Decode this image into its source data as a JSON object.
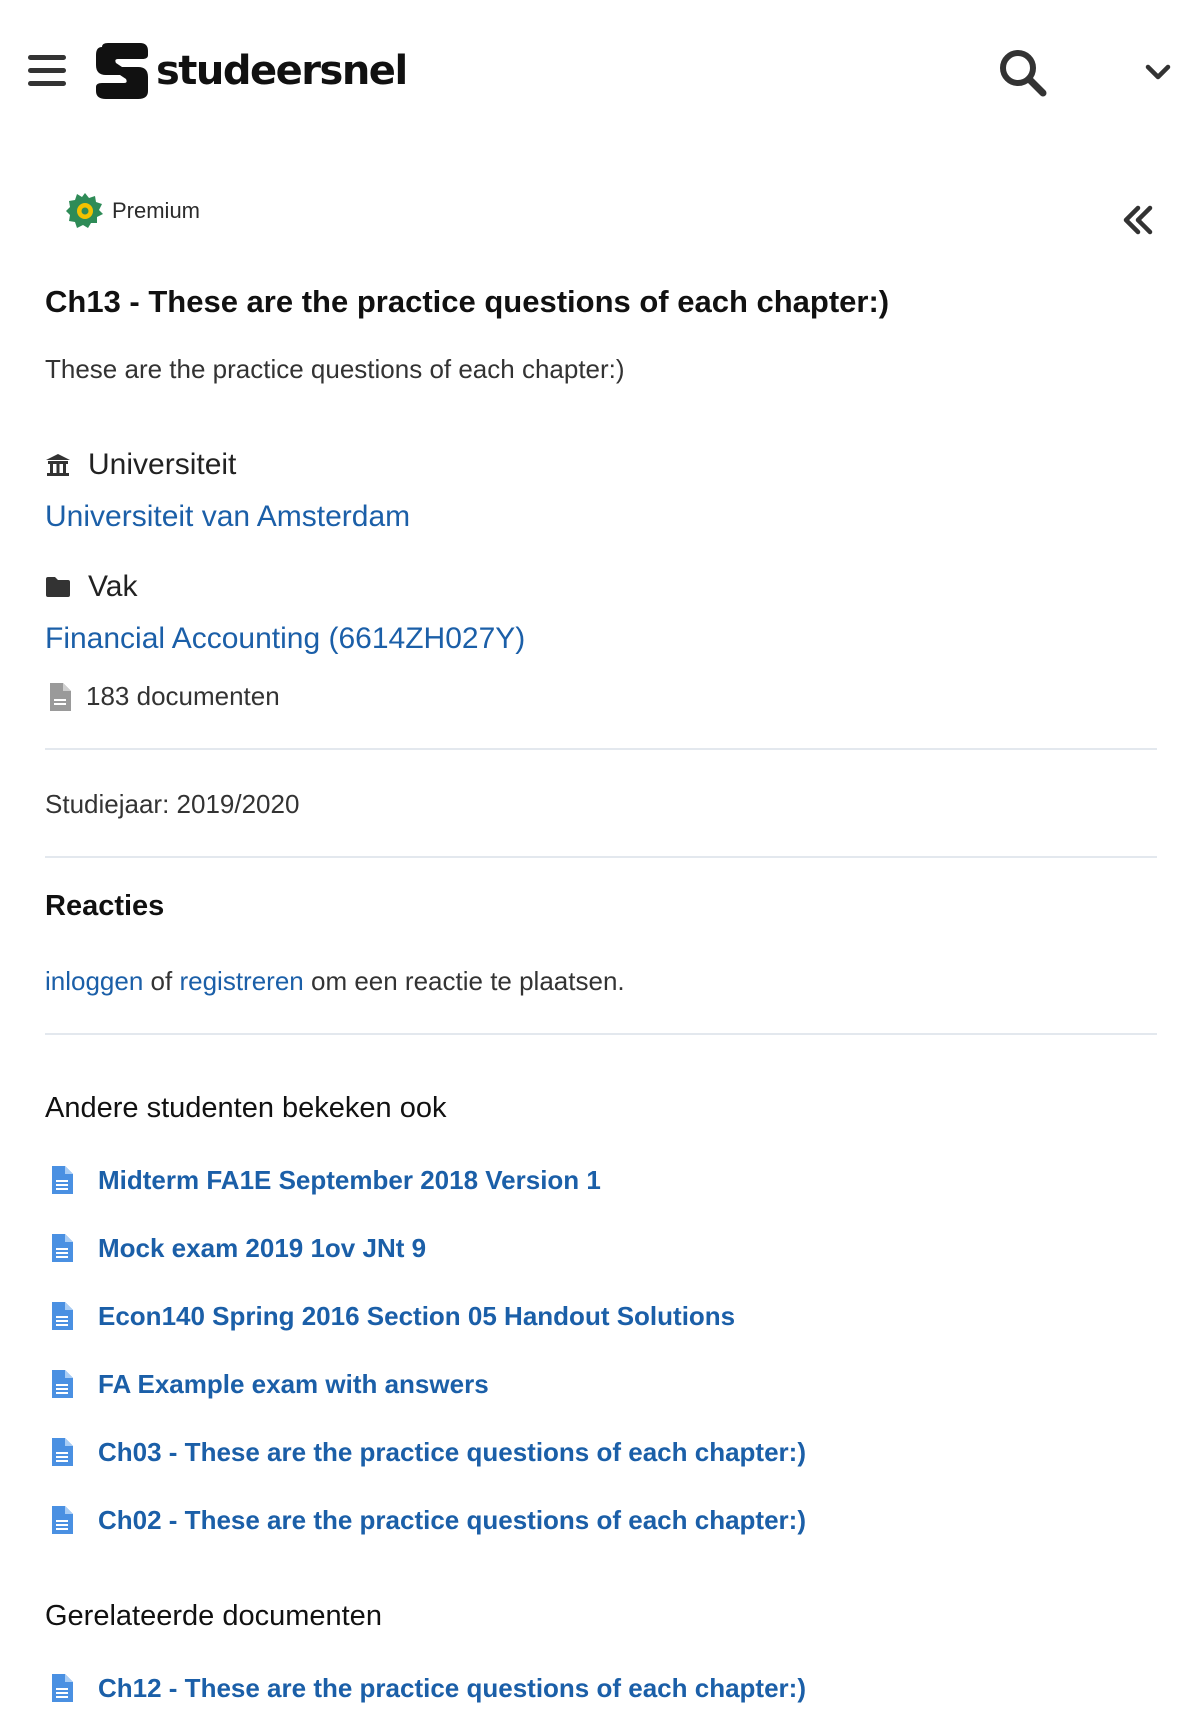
{
  "header": {
    "brand": "studeersnel",
    "menu_icon": "hamburger-menu-icon",
    "search_icon": "search-icon",
    "dropdown_icon": "chevron-down-icon"
  },
  "badge": {
    "label": "Premium",
    "icon": "premium-gear-icon"
  },
  "collapse_icon": "double-chevron-left-icon",
  "document": {
    "title": "Ch13 - These are the practice questions of each chapter:)",
    "description": "These are the practice questions of each chapter:)"
  },
  "university": {
    "heading": "Universiteit",
    "icon": "university-icon",
    "name": "Universiteit van Amsterdam"
  },
  "course": {
    "heading": "Vak",
    "icon": "folder-icon",
    "name": "Financial Accounting (6614ZH027Y)",
    "doc_count": "183 documenten"
  },
  "study_year": "Studiejaar: 2019/2020",
  "comments": {
    "heading": "Reacties",
    "login": "inloggen",
    "or": "of",
    "register": "registreren",
    "rest": "om een reactie te plaatsen."
  },
  "others_viewed": {
    "heading": "Andere studenten bekeken ook",
    "items": [
      "Midterm FA1E September 2018 Version 1",
      "Mock exam 2019 1ov JNt 9",
      "Econ140 Spring 2016 Section 05 Handout Solutions",
      "FA Example exam with answers",
      "Ch03 - These are the practice questions of each chapter:)",
      "Ch02 - These are the practice questions of each chapter:)"
    ]
  },
  "related": {
    "heading": "Gerelateerde documenten",
    "items": [
      "Ch12 - These are the practice questions of each chapter:)"
    ]
  },
  "colors": {
    "link": "#1b5fa8",
    "doc_icon": "#4a90e2",
    "premium": "#2e8b57",
    "premium_center": "#f2c200"
  }
}
